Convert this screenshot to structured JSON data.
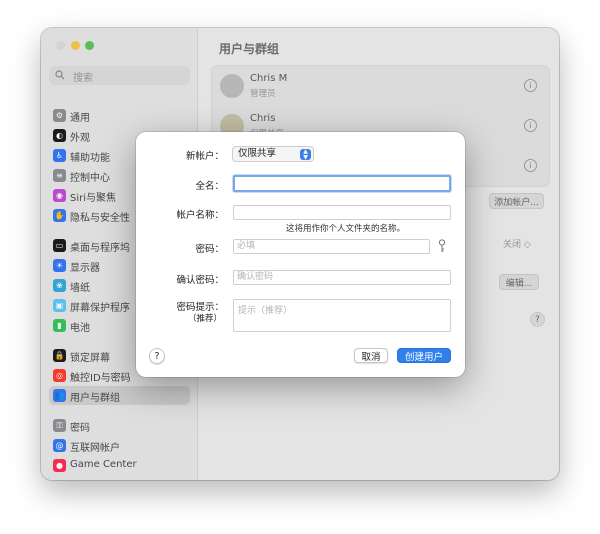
{
  "sidebar": {
    "search_placeholder": "搜索",
    "items": [
      {
        "label": "通用",
        "icon": "gear-icon",
        "color": "#8e8e93"
      },
      {
        "label": "外观",
        "icon": "appearance-icon",
        "color": "#1c1c1e"
      },
      {
        "label": "辅助功能",
        "icon": "accessibility-icon",
        "color": "#3478f6"
      },
      {
        "label": "控制中心",
        "icon": "control-center-icon",
        "color": "#8e8e93"
      },
      {
        "label": "Siri与聚焦",
        "icon": "siri-icon",
        "color": "#c04cd6"
      },
      {
        "label": "隐私与安全性",
        "icon": "hand-icon",
        "color": "#3478f6"
      },
      {
        "label": "桌面与程序坞",
        "icon": "dock-icon",
        "color": "#1c1c1e"
      },
      {
        "label": "显示器",
        "icon": "display-icon",
        "color": "#3478f6"
      },
      {
        "label": "墙纸",
        "icon": "wallpaper-icon",
        "color": "#34aadc"
      },
      {
        "label": "屏幕保护程序",
        "icon": "screensaver-icon",
        "color": "#5ac8fa"
      },
      {
        "label": "电池",
        "icon": "battery-icon",
        "color": "#34c759"
      },
      {
        "label": "锁定屏幕",
        "icon": "lock-icon",
        "color": "#1c1c1e"
      },
      {
        "label": "触控ID与密码",
        "icon": "fingerprint-icon",
        "color": "#ff3b30"
      },
      {
        "label": "用户与群组",
        "icon": "users-icon",
        "color": "#3478f6",
        "selected": true
      },
      {
        "label": "密码",
        "icon": "key-icon",
        "color": "#8e8e93"
      },
      {
        "label": "互联网帐户",
        "icon": "at-icon",
        "color": "#3478f6"
      },
      {
        "label": "Game Center",
        "icon": "game-center-icon",
        "color": "#ff2d55"
      }
    ]
  },
  "main": {
    "title": "用户与群组",
    "users": [
      {
        "name": "Chris M",
        "role": "管理员"
      },
      {
        "name": "Chris",
        "role": "仅限共享"
      }
    ],
    "add_account_button": "添加帐户...",
    "off_label": "关闭 ◇",
    "edit_button": "编辑...",
    "help": "?"
  },
  "dialog": {
    "new_account_label": "新帐户：",
    "new_account_value": "仅限共享",
    "full_name_label": "全名：",
    "full_name_value": "",
    "account_name_label": "帐户名称：",
    "account_name_value": "",
    "account_name_hint": "这将用作你个人文件夹的名称。",
    "password_label": "密码：",
    "password_placeholder": "必填",
    "verify_label": "确认密码：",
    "verify_placeholder": "确认密码",
    "hint_label": "密码提示：",
    "hint_sub_label": "（推荐）",
    "hint_placeholder": "提示（推荐）",
    "help": "?",
    "cancel": "取消",
    "create": "创建用户"
  }
}
